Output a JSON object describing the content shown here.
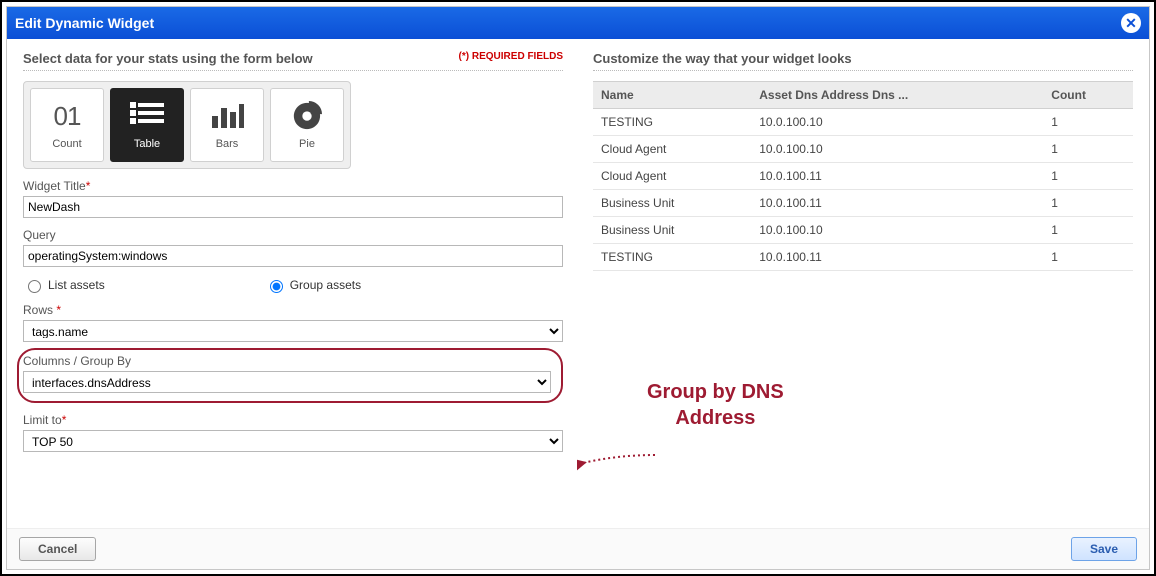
{
  "titlebar": {
    "title": "Edit Dynamic Widget"
  },
  "left": {
    "heading": "Select data for your stats using the form below",
    "required_note": "(*) REQUIRED FIELDS",
    "viz": {
      "count_label": "Count",
      "count_value": "01",
      "table_label": "Table",
      "bars_label": "Bars",
      "pie_label": "Pie"
    },
    "widget_title_label": "Widget Title",
    "widget_title_value": "NewDash",
    "query_label": "Query",
    "query_value": "operatingSystem:windows",
    "radio_list": "List assets",
    "radio_group": "Group assets",
    "rows_label": "Rows ",
    "rows_value": "tags.name",
    "columns_label": "Columns / Group By",
    "columns_value": "interfaces.dnsAddress",
    "limit_label": "Limit to",
    "limit_value": "TOP 50"
  },
  "right": {
    "heading": "Customize the way that your widget looks",
    "cols": {
      "c0": "Name",
      "c1": "Asset Dns Address Dns ...",
      "c2": "Count"
    },
    "rows": [
      {
        "c0": "TESTING",
        "c1": "10.0.100.10",
        "c2": "1"
      },
      {
        "c0": "Cloud Agent",
        "c1": "10.0.100.10",
        "c2": "1"
      },
      {
        "c0": "Cloud Agent",
        "c1": "10.0.100.11",
        "c2": "1"
      },
      {
        "c0": "Business Unit",
        "c1": "10.0.100.11",
        "c2": "1"
      },
      {
        "c0": "Business Unit",
        "c1": "10.0.100.10",
        "c2": "1"
      },
      {
        "c0": "TESTING",
        "c1": "10.0.100.11",
        "c2": "1"
      }
    ]
  },
  "annotation": {
    "line1": "Group by DNS",
    "line2": "Address"
  },
  "footer": {
    "cancel": "Cancel",
    "save": "Save"
  }
}
